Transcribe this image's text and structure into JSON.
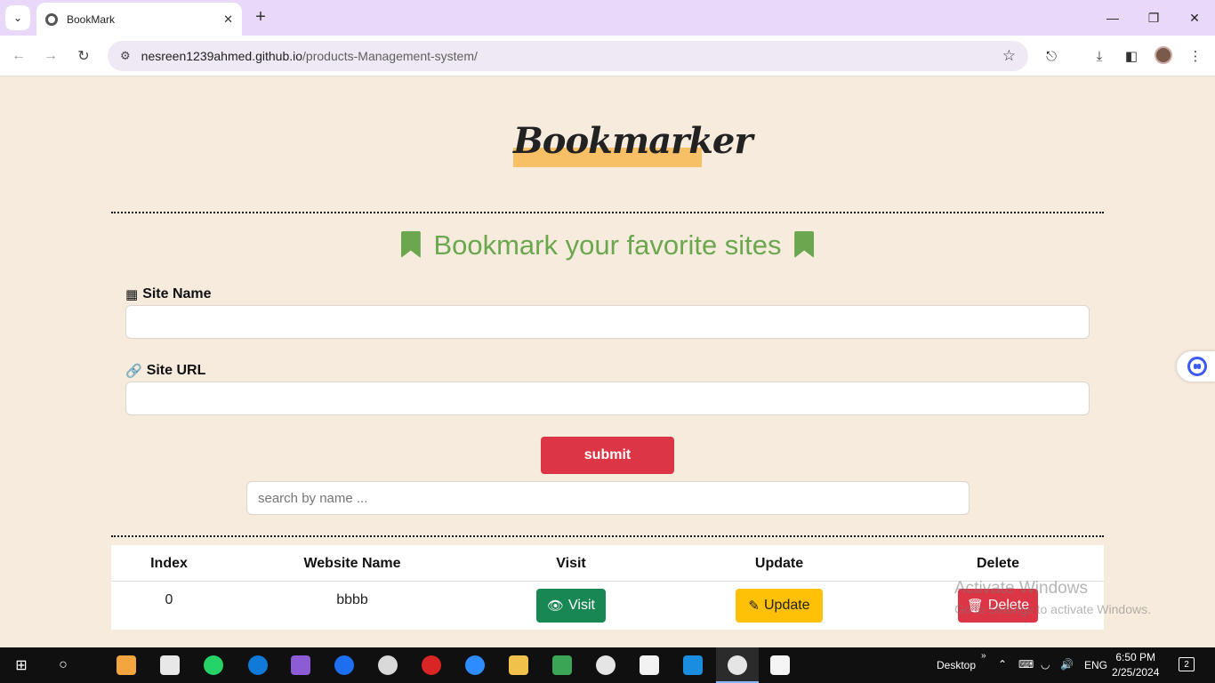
{
  "browser": {
    "tab_title": "BookMark",
    "url_host": "nesreen1239ahmed.github.io",
    "url_path": "/products-Management-system/"
  },
  "page": {
    "brand": "Bookmarker",
    "heading": "Bookmark your favorite sites",
    "site_name_label": "Site Name",
    "site_url_label": "Site URL",
    "site_name_value": "",
    "site_url_value": "",
    "submit_label": "submit",
    "search_placeholder": "search by name ...",
    "accent_color": "#6aa74e"
  },
  "table": {
    "headers": [
      "Index",
      "Website Name",
      "Visit",
      "Update",
      "Delete"
    ],
    "rows": [
      {
        "index": "0",
        "name": "bbbb",
        "visit": "Visit",
        "update": "Update",
        "delete": "Delete"
      }
    ]
  },
  "watermark": {
    "title": "Activate Windows",
    "subtitle": "Go to Settings to activate Windows."
  },
  "taskbar": {
    "desktop_label": "Desktop",
    "language": "ENG",
    "time": "6:50 PM",
    "date": "2/25/2024",
    "notifications": "2"
  }
}
